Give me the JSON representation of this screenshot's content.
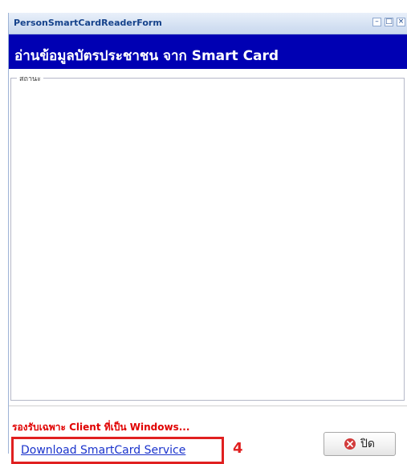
{
  "window": {
    "title": "PersonSmartCardReaderForm",
    "minimize_glyph": "–",
    "maximize_glyph": "□",
    "close_glyph": "×"
  },
  "header": {
    "title": "อ่านข้อมูลบัตรประชาชน จาก Smart Card",
    "background_color": "#0000b3"
  },
  "status_group": {
    "legend": "สถานะ"
  },
  "footer": {
    "notice": "รองรับเฉพาะ Client ที่เป็น Windows...",
    "download_link": "Download SmartCard Service",
    "annotation_number": "4",
    "close_button_label": "ปิด",
    "close_button_icon": "close-circle-icon"
  },
  "colors": {
    "header_band": "#0000b3",
    "notice_text": "#e00000",
    "link_text": "#1a33cc",
    "annotation": "#e02020"
  }
}
